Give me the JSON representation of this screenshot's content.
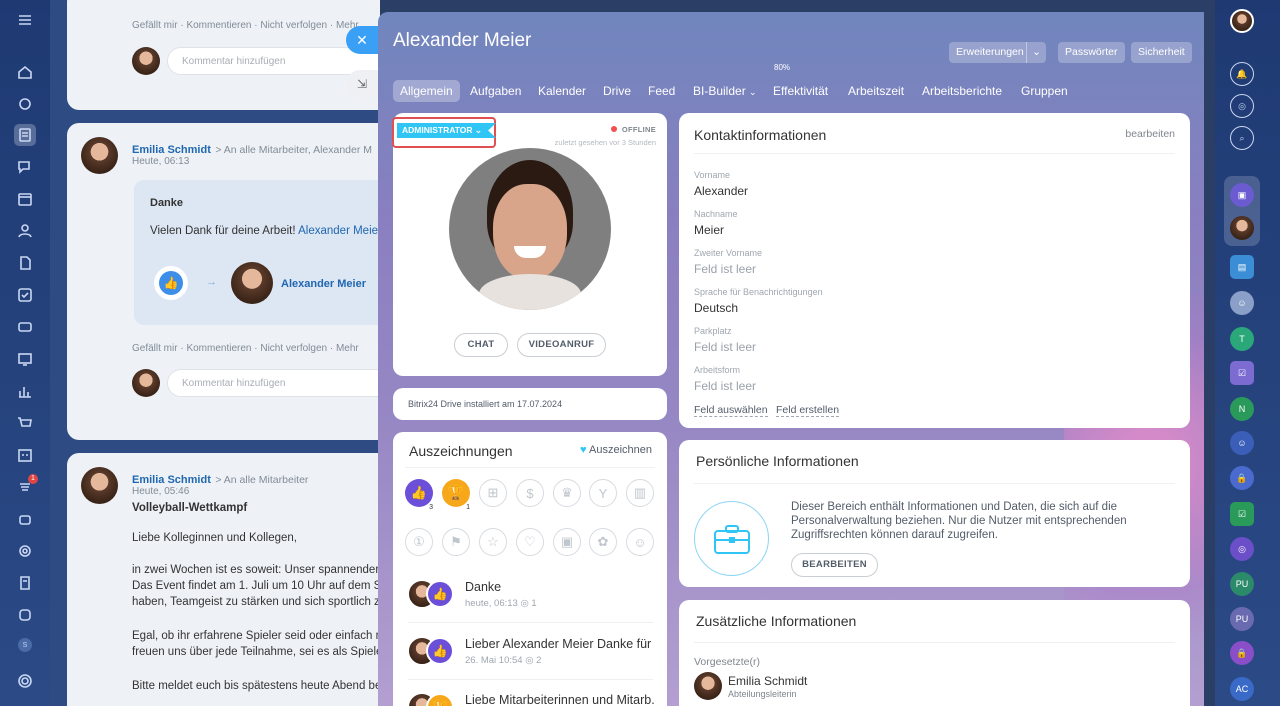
{
  "sidebar": {
    "icons": [
      "menu-icon",
      "home-icon",
      "bot-icon",
      "feed-icon",
      "chat-icon",
      "calendar-icon",
      "group-icon",
      "doc-icon",
      "tasks-icon",
      "crm-icon",
      "sites-icon",
      "analytics-icon",
      "shop-icon",
      "booking-icon",
      "notification-icon",
      "robot-icon",
      "target-icon",
      "invoice-icon",
      "store-icon",
      "s-icon",
      "settings-icon"
    ],
    "notify_count": "1",
    "s_label": "S"
  },
  "feed": {
    "post1": {
      "actions": "Gefällt mir · Kommentieren · Nicht verfolgen · Mehr",
      "comment_placeholder": "Kommentar hinzufügen"
    },
    "post2": {
      "author": "Emilia Schmidt",
      "to": "> An alle Mitarbeiter, Alexander M",
      "time": "Heute, 06:13",
      "title": "Danke",
      "text": "Vielen Dank für deine Arbeit!",
      "mention": "Alexander Meie",
      "recipient": "Alexander Meier",
      "actions": "Gefällt mir · Kommentieren · Nicht verfolgen · Mehr",
      "comment_placeholder": "Kommentar hinzufügen"
    },
    "post3": {
      "author": "Emilia Schmidt",
      "to": "> An alle Mitarbeiter",
      "time": "Heute, 05:46",
      "title": "Volleyball-Wettkampf",
      "p1": "Liebe Kolleginnen und Kollegen,",
      "p2a": "in zwei Wochen ist es soweit: Unser spannender",
      "p2b": "Das Event findet am 1. Juli um 10 Uhr auf dem Sp",
      "p2c": "haben, Teamgeist zu stärken und sich sportlich z",
      "p3a": "Egal, ob ihr erfahrene Spieler seid oder einfach n",
      "p3b": "freuen uns über jede Teilnahme, sei es als Spiele",
      "p4": "Bitte meldet euch bis spätestens heute Abend be"
    }
  },
  "slider": {
    "title": "Alexander Meier",
    "buttons": {
      "extensions": "Erweiterungen",
      "passwords": "Passwörter",
      "security": "Sicherheit"
    },
    "tabs": [
      "Allgemein",
      "Aufgaben",
      "Kalender",
      "Drive",
      "Feed",
      "BI-Builder",
      "Effektivität",
      "Arbeitszeit",
      "Arbeitsberichte",
      "Gruppen"
    ],
    "efficiency_badge": "80%",
    "profile": {
      "role": "ADMINISTRATOR",
      "status": "OFFLINE",
      "last_seen": "zuletzt gesehen vor 3 Stunden",
      "chat": "CHAT",
      "video": "VIDEOANRUF"
    },
    "drive": "Bitrix24 Drive installiert am 17.07.2024",
    "awards": {
      "title": "Auszeichnungen",
      "action": "Auszeichnen",
      "count1": "3",
      "count2": "1",
      "messages": [
        {
          "text": "Danke",
          "meta": "heute, 06:13",
          "views": "1"
        },
        {
          "text": "Lieber Alexander Meier Danke für ...",
          "meta": "26. Mai 10:54",
          "views": "2"
        },
        {
          "text": "Liebe Mitarbeiterinnen und Mitarb...",
          "meta": "",
          "views": ""
        }
      ]
    },
    "contact": {
      "title": "Kontaktinformationen",
      "edit": "bearbeiten",
      "fields": [
        {
          "label": "Vorname",
          "value": "Alexander"
        },
        {
          "label": "Nachname",
          "value": "Meier"
        },
        {
          "label": "Zweiter Vorname",
          "value": "Feld ist leer"
        },
        {
          "label": "Sprache für Benachrichtigungen",
          "value": "Deutsch"
        },
        {
          "label": "Parkplatz",
          "value": "Feld ist leer"
        },
        {
          "label": "Arbeitsform",
          "value": "Feld ist leer"
        }
      ],
      "select_field": "Feld auswählen",
      "create_field": "Feld erstellen"
    },
    "personal": {
      "title": "Persönliche Informationen",
      "text": "Dieser Bereich enthält Informationen und Daten, die sich auf die Personalverwaltung beziehen. Nur die Nutzer mit entsprechenden Zugriffsrechten können darauf zugreifen.",
      "button": "BEARBEITEN"
    },
    "additional": {
      "title": "Zusätzliche Informationen",
      "sup_label": "Vorgesetzte(r)",
      "sup_name": "Emilia Schmidt",
      "sup_role": "Abteilungsleiterin"
    }
  },
  "right_sidebar": {
    "labels": [
      "T",
      "N",
      "PU",
      "PU",
      "AC"
    ]
  },
  "colors": {
    "accent": "#2fc6f6",
    "primary": "#2067b0",
    "highlight": "#e05050"
  }
}
